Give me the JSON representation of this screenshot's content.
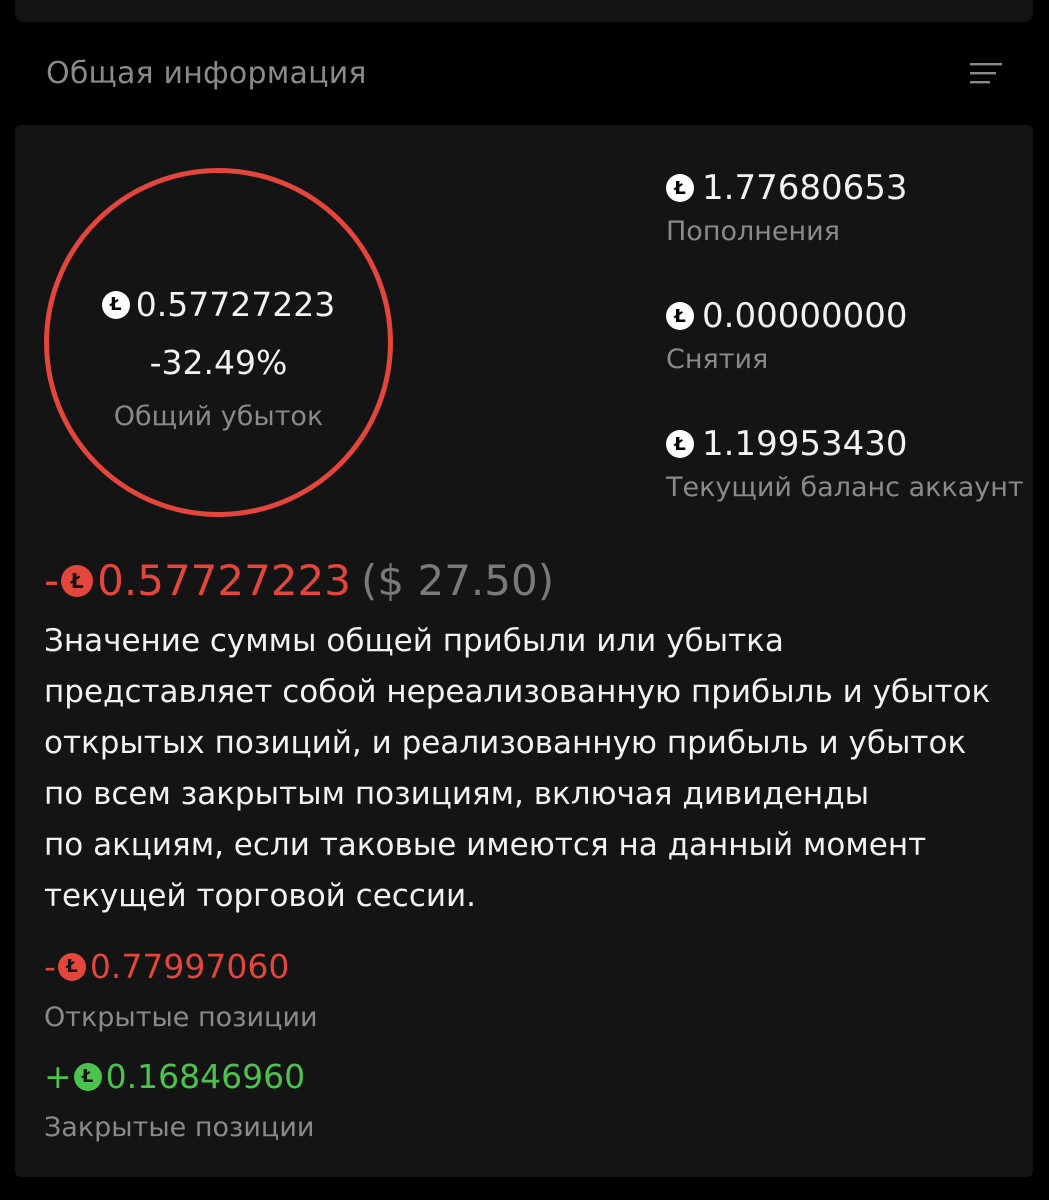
{
  "header": {
    "title": "Общая информация",
    "filter_icon": "filter-lines-icon"
  },
  "colors": {
    "loss": "#e2463c",
    "profit": "#4cc24f",
    "muted": "#8a8a8a",
    "card": "#141414"
  },
  "currency_icon": "litecoin-icon",
  "summary": {
    "ring_value": "0.57727223",
    "ring_percent": "-32.49%",
    "ring_label": "Общий убыток"
  },
  "stats": [
    {
      "value": "1.77680653",
      "label": "Пополнения"
    },
    {
      "value": "0.00000000",
      "label": "Снятия"
    },
    {
      "value": "1.19953430",
      "label": "Текущий баланс аккаунт"
    }
  ],
  "total": {
    "sign": "-",
    "value": "0.57727223",
    "usd": "($ 27.50)"
  },
  "description_lines": [
    "Значение суммы общей прибыли или убытка",
    "представляет собой нереализованную прибыль и убыток",
    "открытых позиций, и реализованную прибыль и убыток",
    "по всем закрытым позициям, включая дивиденды",
    "по акциям, если таковые имеются на данный момент",
    "текущей торговой сессии."
  ],
  "positions": {
    "open": {
      "sign": "-",
      "value": "0.77997060",
      "label": "Открытые позиции"
    },
    "closed": {
      "sign": "+",
      "value": "0.16846960",
      "label": "Закрытые позиции"
    }
  }
}
